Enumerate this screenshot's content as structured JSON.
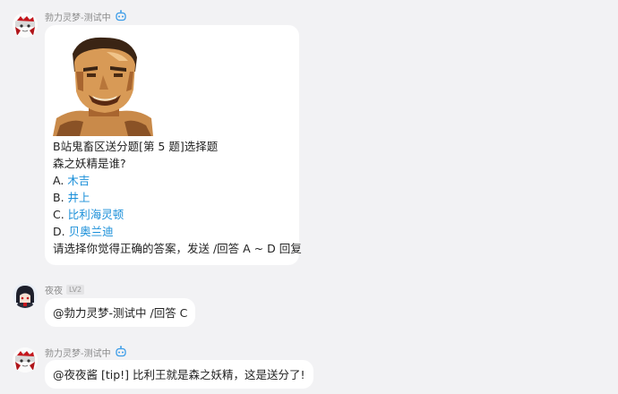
{
  "messages": [
    {
      "sender": "勃力灵梦-测试中",
      "is_bot": true,
      "lines": {
        "title": "B站鬼畜区送分题[第 5 题]选择题",
        "question": "森之妖精是谁?",
        "options": [
          {
            "letter": "A.",
            "text": "木吉"
          },
          {
            "letter": "B.",
            "text": "井上"
          },
          {
            "letter": "C.",
            "text": "比利海灵顿"
          },
          {
            "letter": "D.",
            "text": "贝奥兰迪"
          }
        ],
        "instruction": "请选择你觉得正确的答案，发送 /回答 A ~ D 回复"
      }
    },
    {
      "sender": "夜夜",
      "level": "LV2",
      "text": "@勃力灵梦-测试中 /回答 C"
    },
    {
      "sender": "勃力灵梦-测试中",
      "is_bot": true,
      "text": "@夜夜酱 [tip!] 比利王就是森之妖精，这是送分了!"
    }
  ],
  "colors": {
    "background": "#f2f2f4",
    "bubble": "#ffffff",
    "option_link": "#1a8fd9",
    "sender_name": "#8a8a8a",
    "bot_badge": "#3b9ce8"
  },
  "icons": {
    "bot_badge": "robot-icon"
  }
}
